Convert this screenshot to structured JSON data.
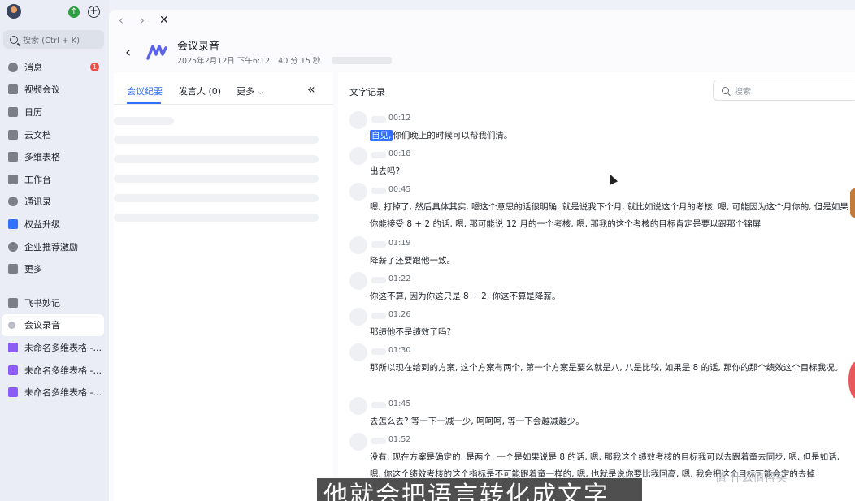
{
  "sidebar": {
    "search_placeholder": "搜索 (Ctrl + K)",
    "items": [
      {
        "label": "消息",
        "icon": "chat-icon",
        "badge": "1"
      },
      {
        "label": "视频会议",
        "icon": "video-icon"
      },
      {
        "label": "日历",
        "icon": "calendar-icon"
      },
      {
        "label": "云文档",
        "icon": "docs-icon"
      },
      {
        "label": "多维表格",
        "icon": "base-icon"
      },
      {
        "label": "工作台",
        "icon": "workplace-icon"
      },
      {
        "label": "通讯录",
        "icon": "contacts-icon"
      },
      {
        "label": "权益升级",
        "icon": "upgrade-icon"
      },
      {
        "label": "企业推荐激励",
        "icon": "referral-icon"
      },
      {
        "label": "更多",
        "icon": "more-apps-icon"
      }
    ],
    "pinned": [
      {
        "label": "飞书妙记",
        "icon": "minutes-icon"
      },
      {
        "label": "会议录音",
        "icon": "recording-icon",
        "active": true
      },
      {
        "label": "未命名多维表格 -...",
        "icon": "base-icon"
      },
      {
        "label": "未命名多维表格 -...",
        "icon": "base-icon"
      },
      {
        "label": "未命名多维表格 -...",
        "icon": "base-icon"
      }
    ]
  },
  "header": {
    "title": "会议录音",
    "date": "2025年2月12日 下午6:12",
    "duration": "40 分 15 秒"
  },
  "left_panel": {
    "tabs": [
      "会议纪要",
      "发言人 (0)",
      "更多"
    ],
    "collapse_icon": "double-chevron-left-icon"
  },
  "transcript": {
    "title": "文字记录",
    "search_placeholder": "搜索",
    "highlight": "自见,",
    "segments": [
      {
        "time": "00:12",
        "text": "你们晚上的时候可以帮我们清。"
      },
      {
        "time": "00:18",
        "text": "出去吗?"
      },
      {
        "time": "00:45",
        "text": "嗯, 打掉了, 然后具体其实, 嗯这个意思的话很明确, 就是说我下个月, 就比如说这个月的考核, 嗯, 可能因为这个月你的, 但是如果你能接受 8 + 2 的话, 嗯, 那可能说 12 月的一个考核, 嗯, 那我的这个考核的目标肯定是要以跟那个锦屏"
      },
      {
        "time": "01:19",
        "text": "降薪了还要跟他一致。"
      },
      {
        "time": "01:22",
        "text": "你这不算, 因为你这只是 8 + 2, 你这不算是降薪。"
      },
      {
        "time": "01:26",
        "text": "那绩他不是绩效了吗?"
      },
      {
        "time": "01:30",
        "text": "那所以现在给到的方案, 这个方案有两个, 第一个方案是要么就是八, 八是比较, 如果是 8 的话, 那你的那个绩效这个目标我况。"
      },
      {
        "time": "01:45",
        "text": "去怎么去? 等一下一减一少, 呵呵呵, 等一下会越减越少。"
      },
      {
        "time": "01:52",
        "text": "没有, 现在方案是确定的, 是两个, 一个是如果说是 8 的话, 嗯, 那我这个绩效考核的目标我可以去跟着童去同步, 嗯, 但是如话, 嗯, 你这个绩效考核的这个指标是不可能跟着童一样的, 嗯, 也就是说你要比我回高, 嗯, 我会把这个目标可能会定的去掉"
      }
    ]
  },
  "overlay": {
    "subtitle": "他就会把语言转化成文字",
    "watermark": "值 什么值得买"
  }
}
